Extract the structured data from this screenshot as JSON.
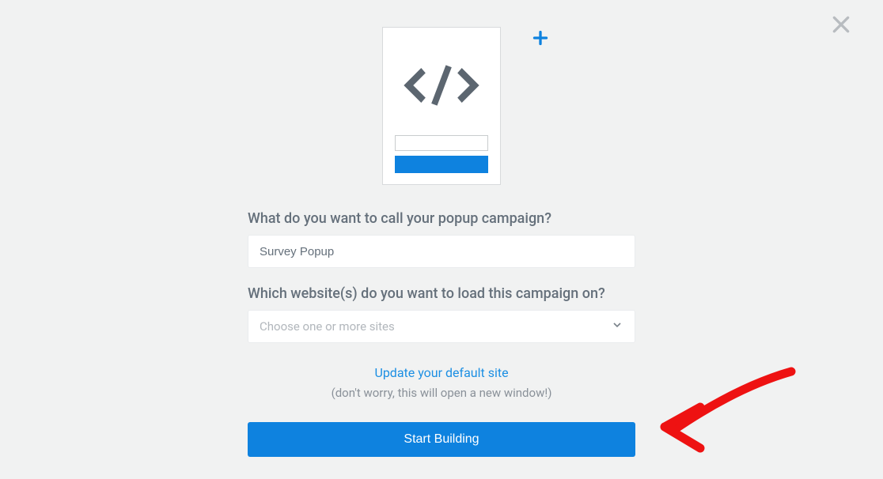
{
  "close": {
    "name": "close-icon"
  },
  "preview": {
    "code_name": "code-icon"
  },
  "form": {
    "name_label": "What do you want to call your popup campaign?",
    "name_value": "Survey Popup",
    "website_label": "Which website(s) do you want to load this campaign on?",
    "website_placeholder": "Choose one or more sites",
    "update_link": "Update your default site",
    "update_hint": "(don't worry, this will open a new window!)",
    "submit_label": "Start Building"
  }
}
